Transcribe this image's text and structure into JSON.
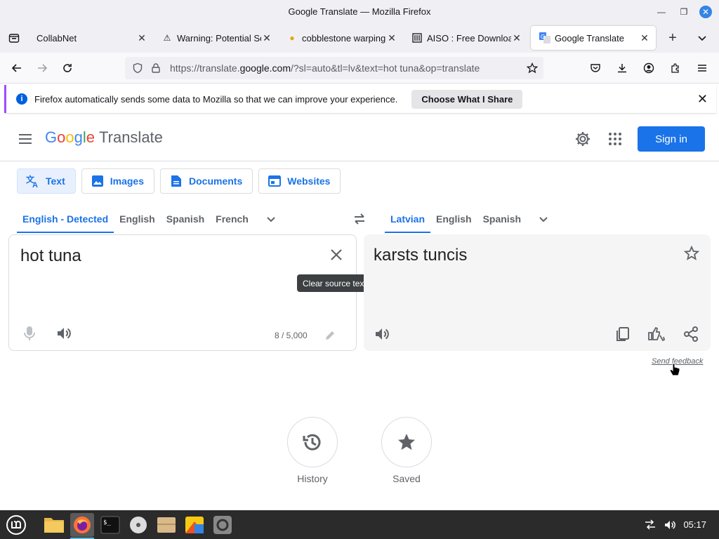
{
  "window": {
    "title": "Google Translate — Mozilla Firefox"
  },
  "tabs": [
    {
      "label": "CollabNet",
      "icon": "none"
    },
    {
      "label": "Warning: Potential Se",
      "icon": "warning-icon"
    },
    {
      "label": "cobblestone warping",
      "icon": "coin-icon"
    },
    {
      "label": "AISO : Free Downloa",
      "icon": "building-icon"
    },
    {
      "label": "Google Translate",
      "icon": "google-translate-icon",
      "active": true
    }
  ],
  "url": {
    "prefix": "https://translate.",
    "host": "google.com",
    "rest": "/?sl=auto&tl=lv&text=hot tuna&op=translate"
  },
  "notice": {
    "text": "Firefox automatically sends some data to Mozilla so that we can improve your experience.",
    "button": "Choose What I Share"
  },
  "gt": {
    "logo_letters": [
      "G",
      "o",
      "o",
      "g",
      "l",
      "e"
    ],
    "logo_word": "Translate",
    "signin": "Sign in",
    "modes": [
      "Text",
      "Images",
      "Documents",
      "Websites"
    ],
    "source_langs": [
      "English - Detected",
      "English",
      "Spanish",
      "French"
    ],
    "target_langs": [
      "Latvian",
      "English",
      "Spanish"
    ],
    "source_text": "hot tuna",
    "char_count": "8 / 5,000",
    "tooltip": "Clear source text",
    "target_text": "karsts tuncis",
    "feedback": "Send feedback",
    "history": "History",
    "saved": "Saved"
  },
  "taskbar": {
    "time": "05:17"
  },
  "colors": {
    "accent": "#1a73e8",
    "firefox_accent": "#0060df"
  }
}
